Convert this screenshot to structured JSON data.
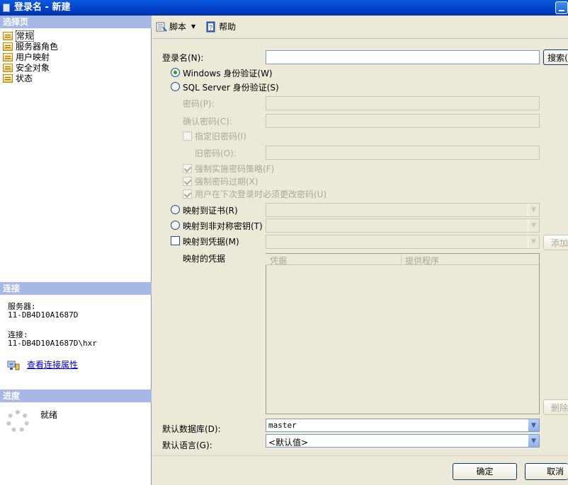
{
  "window": {
    "title": "登录名 - 新建"
  },
  "left_pane": {
    "select_page_header": "选择页",
    "pages": [
      {
        "label": "常规",
        "selected": true
      },
      {
        "label": "服务器角色",
        "selected": false
      },
      {
        "label": "用户映射",
        "selected": false
      },
      {
        "label": "安全对象",
        "selected": false
      },
      {
        "label": "状态",
        "selected": false
      }
    ],
    "connection_header": "连接",
    "server_label": "服务器:",
    "server_value": "11-DB4D10A1687D",
    "connection_label": "连接:",
    "connection_value": "11-DB4D10A1687D\\hxr",
    "view_connection_properties": "查看连接属性",
    "progress_header": "进度",
    "progress_status": "就绪"
  },
  "toolbar": {
    "script_label": "脚本",
    "help_label": "帮助"
  },
  "form": {
    "login_name_label": "登录名(N):",
    "login_name_value": "",
    "search_button": "搜索(",
    "windows_auth_label": "Windows 身份验证(W)",
    "sql_auth_label": "SQL Server 身份验证(S)",
    "password_label": "密码(P):",
    "confirm_password_label": "确认密码(C):",
    "specify_old_password_label": "指定旧密码(I)",
    "old_password_label": "旧密码(O):",
    "enforce_policy_label": "强制实施密码策略(F)",
    "enforce_expiration_label": "强制密码过期(X)",
    "must_change_label": "用户在下次登录时必须更改密码(U)",
    "map_cert_label": "映射到证书(R)",
    "map_asym_key_label": "映射到非对称密钥(T)",
    "map_credential_label": "映射到凭据(M)",
    "add_button": "添加",
    "mapped_credentials_label": "映射的凭据",
    "credentials_columns": [
      "凭据",
      "提供程序"
    ],
    "remove_button": "删除",
    "default_db_label": "默认数据库(D):",
    "default_db_value": "master",
    "default_lang_label": "默认语言(G):",
    "default_lang_value": "<默认值>"
  },
  "footer": {
    "ok_button": "确定",
    "cancel_button": "取消"
  }
}
